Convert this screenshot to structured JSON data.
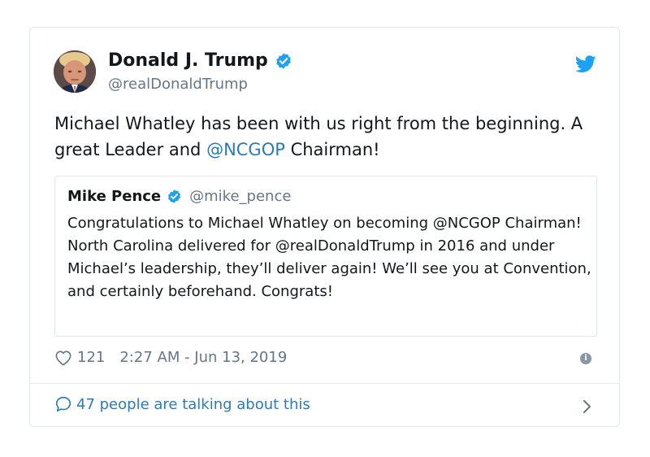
{
  "tweet": {
    "author_name": "Donald J. Trump",
    "author_handle": "@realDonaldTrump",
    "text_before": "Michael Whatley has been with us right from the beginning. A great Leader and ",
    "text_mention": "@NCGOP",
    "text_after": " Chairman!",
    "likes": "121",
    "timestamp": "2:27 AM - Jun 13, 2019",
    "talking": "47 people are talking about this"
  },
  "quoted": {
    "author_name": "Mike Pence",
    "author_handle": "@mike_pence",
    "text": "Congratulations to Michael Whatley on becoming @NCGOP Chairman! North Carolina delivered for @realDonaldTrump in 2016 and under Michael’s leadership, they’ll deliver again! We’ll see you at Convention, and certainly beforehand. Congrats!"
  },
  "icons": {
    "verified": "verified-badge-icon",
    "brand": "twitter-bird-icon",
    "like": "heart-icon",
    "info": "info-icon",
    "reply": "chat-bubble-icon",
    "more": "chevron-right-icon"
  },
  "colors": {
    "link": "#2b7bb9",
    "verified": "#1da1f2",
    "secondary_text": "#657786",
    "border": "#e1e8ed"
  }
}
